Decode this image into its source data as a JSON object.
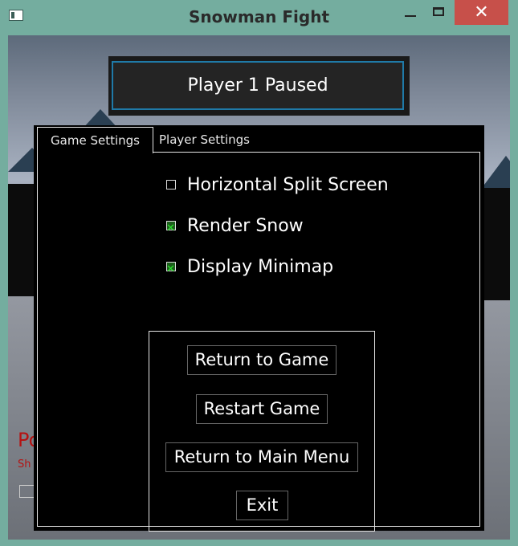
{
  "window": {
    "title": "Snowman Fight",
    "controls": {
      "minimize": "",
      "maximize": "",
      "close": "✕"
    }
  },
  "hud": {
    "side_text_large": "Po",
    "side_text_small": "Sh"
  },
  "pause_banner": {
    "text": "Player 1 Paused"
  },
  "tabs": [
    {
      "label": "Game Settings",
      "active": true
    },
    {
      "label": "Player Settings",
      "active": false
    }
  ],
  "options": [
    {
      "label": "Horizontal Split Screen",
      "checked": false
    },
    {
      "label": "Render Snow",
      "checked": true
    },
    {
      "label": "Display Minimap",
      "checked": true
    }
  ],
  "buttons": {
    "return_to_game": "Return to Game",
    "restart_game": "Restart Game",
    "return_to_main_menu": "Return to Main Menu",
    "exit": "Exit"
  },
  "colors": {
    "titlebar": "#74ad9f",
    "close_button": "#c7504a",
    "banner_border": "#1f7aa8",
    "check_mark": "#2ee32e"
  }
}
